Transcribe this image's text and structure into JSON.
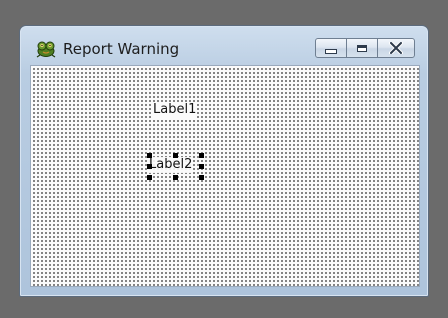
{
  "window": {
    "title": "Report Warning",
    "app_icon": "frog-icon",
    "buttons": {
      "minimize": "minimize-icon",
      "maximize": "maximize-icon",
      "close": "close-icon"
    }
  },
  "form": {
    "grid": "dotted-design-grid",
    "labels": [
      {
        "text": "Label1",
        "selected": false
      },
      {
        "text": "Label2",
        "selected": true
      }
    ]
  },
  "colors": {
    "desktop": "#6b6b6b",
    "titlebar": "#b9cde2",
    "form_background": "#fbfbfb",
    "grid_dot": "#2a2a2a",
    "selection_handle": "#000000"
  }
}
